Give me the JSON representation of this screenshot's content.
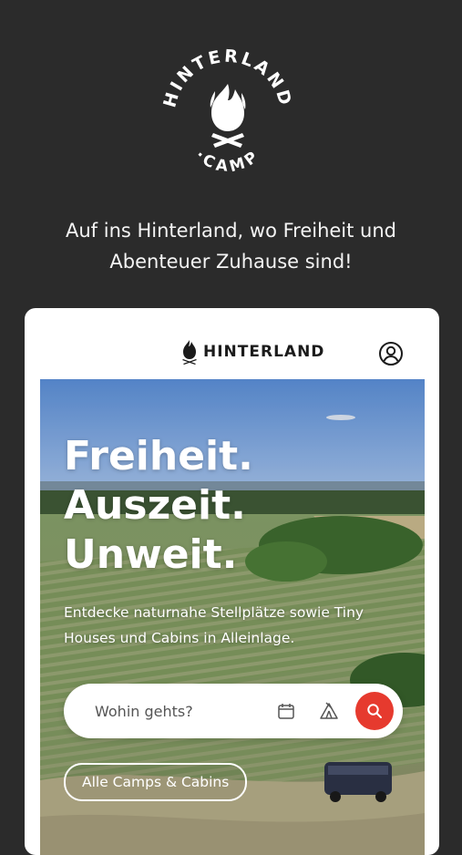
{
  "logo": {
    "top_text": "HINTERLAND",
    "bottom_text": "·CAMP"
  },
  "tagline": {
    "line1": "Auf ins Hinterland, wo Freiheit und",
    "line2": "Abenteuer Zuhause sind!"
  },
  "card": {
    "brand": "HINTERLAND",
    "hero": {
      "headline": [
        "Freiheit.",
        "Auszeit.",
        "Unweit."
      ],
      "subline": "Entdecke naturnahe Stellplätze sowie Tiny Houses und Cabins in Alleinlage.",
      "search": {
        "placeholder": "Wohin gehts?"
      },
      "cta_label": "Alle Camps & Cabins"
    }
  },
  "colors": {
    "background": "#2b2b2b",
    "accent": "#e63a2e",
    "card": "#ffffff"
  },
  "icons": [
    "fire-logo-icon",
    "account-icon",
    "calendar-icon",
    "tent-icon",
    "search-icon"
  ]
}
